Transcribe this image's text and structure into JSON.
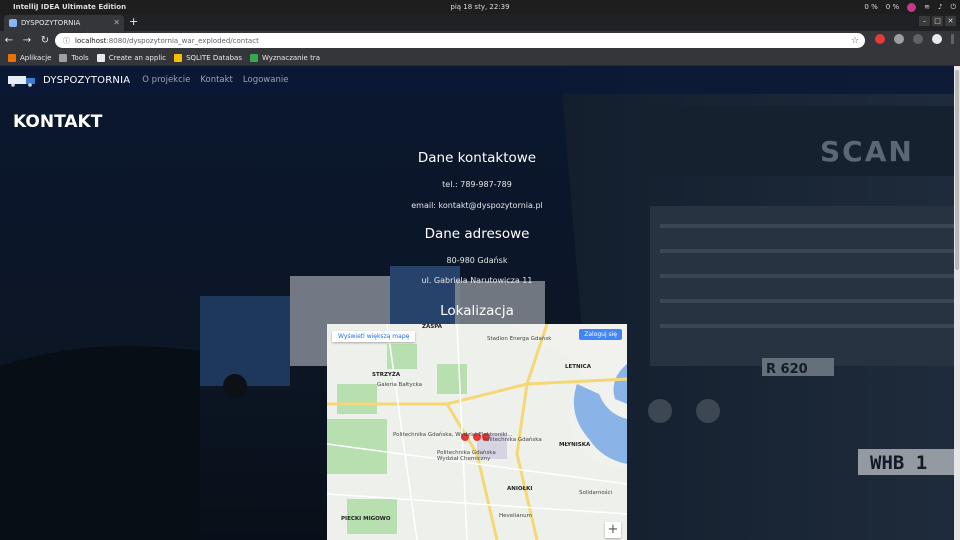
{
  "os": {
    "app_name": "IntelliJ IDEA Ultimate Edition",
    "clock": "pią 18 sty, 22:39",
    "tray_a": "0 %",
    "tray_b": "0 %"
  },
  "browser": {
    "tab_title": "DYSPOZYTORNIA",
    "url_host": "localhost",
    "url_path": ":8080/dyspozytornia_war_exploded/contact",
    "bookmarks": [
      {
        "label": "Aplikacje",
        "color": "#e8710a"
      },
      {
        "label": "Tools",
        "color": "#9aa0a6"
      },
      {
        "label": "Create an applic",
        "color": "#e8eaed"
      },
      {
        "label": "SQLITE Databas",
        "color": "#fbbc04"
      },
      {
        "label": "Wyznaczanie tra",
        "color": "#34a853"
      }
    ]
  },
  "site": {
    "brand": "DYSPOZYTORNIA",
    "nav": [
      "O projekcie",
      "Kontakt",
      "Logowanie"
    ],
    "page_title": "KONTAKT",
    "contact": {
      "heading": "Dane kontaktowe",
      "phone": "tel.: 789-987-789",
      "email": "email: kontakt@dyspozytornia.pl"
    },
    "address": {
      "heading": "Dane adresowe",
      "city": "80-980 Gdańsk",
      "street": "ul. Gabriela Narutowicza 11"
    },
    "location": {
      "heading": "Lokalizacja"
    }
  },
  "map": {
    "larger_map": "Wyświetl większą mapę",
    "sign_in": "Zaloguj się",
    "zoom_in": "+",
    "labels": [
      "ZASPA",
      "Stadion Energa Gdańsk",
      "STRZYŻA",
      "LETNICA",
      "Galeria Bałtycka",
      "Politechnika Gdańska, Wydział Elektroniki...",
      "Politechnika Gdańska",
      "Politechnika Gdańska Wydział Chemiczny",
      "MŁYNISKA",
      "ANIOŁKI",
      "PIECKI MIGOWO",
      "Hevelianum",
      "Solidarności"
    ]
  },
  "colors": {
    "nav_bg": "#0a1937",
    "map_water": "#8ab4e8",
    "map_road": "#f5d776",
    "map_park": "#b8dfb0",
    "pin": "#e53935"
  }
}
